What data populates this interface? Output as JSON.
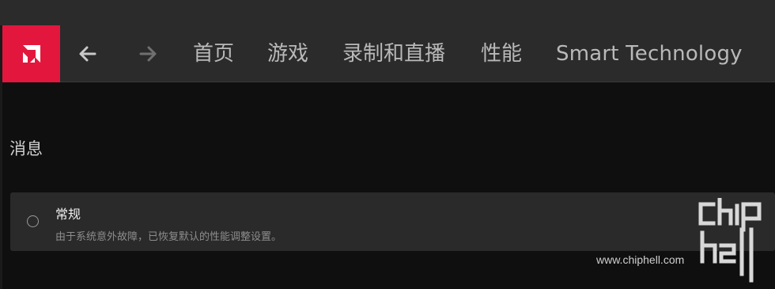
{
  "nav": {
    "logo_icon": "amd-logo-icon",
    "back_icon": "arrow-left-icon",
    "forward_icon": "arrow-right-icon",
    "tabs": [
      {
        "label": "首页"
      },
      {
        "label": "游戏"
      },
      {
        "label": "录制和直播"
      },
      {
        "label": "性能"
      },
      {
        "label": "Smart Technology"
      }
    ]
  },
  "section": {
    "title": "消息"
  },
  "message": {
    "title": "常规",
    "description": "由于系统意外故障，已恢复默认的性能调整设置。"
  },
  "watermark": {
    "text": "www.chiphell.com",
    "logo": "chiphell-logo"
  },
  "colors": {
    "brand": "#e3173d",
    "navbar": "#2b2b2b",
    "background": "#0f0f0f",
    "card": "#2a2a2a"
  }
}
